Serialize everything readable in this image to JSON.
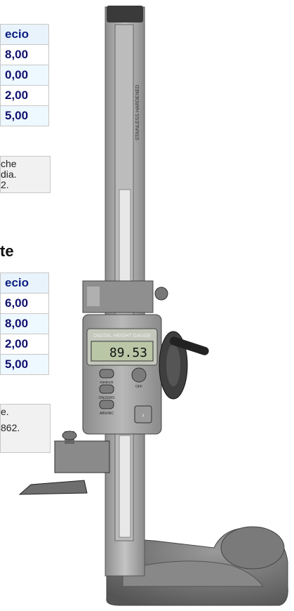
{
  "table1": {
    "header": "ecio",
    "rows": [
      "8,00",
      "0,00",
      "2,00",
      "5,00"
    ],
    "note": [
      "che",
      "dia.",
      "2."
    ]
  },
  "heading2": "te",
  "table2": {
    "header": "ecio",
    "rows": [
      "6,00",
      "8,00",
      "2,00",
      "5,00"
    ],
    "note": [
      "e.",
      "",
      "862."
    ]
  },
  "gauge": {
    "brand": "DIGITAL HEIGHT GAUGE",
    "reading": "89.53",
    "buttons": {
      "mm_inch": "mm/inch",
      "on_zero": "ON/ZERO",
      "abs_inc": "ABS/INC",
      "off": "OFF"
    },
    "scale_label": "STAINLESS HARDENED",
    "colors": {
      "body": "#9a9a9a",
      "lcd": "#b9c7a7",
      "base": "#6e6e6e"
    }
  }
}
